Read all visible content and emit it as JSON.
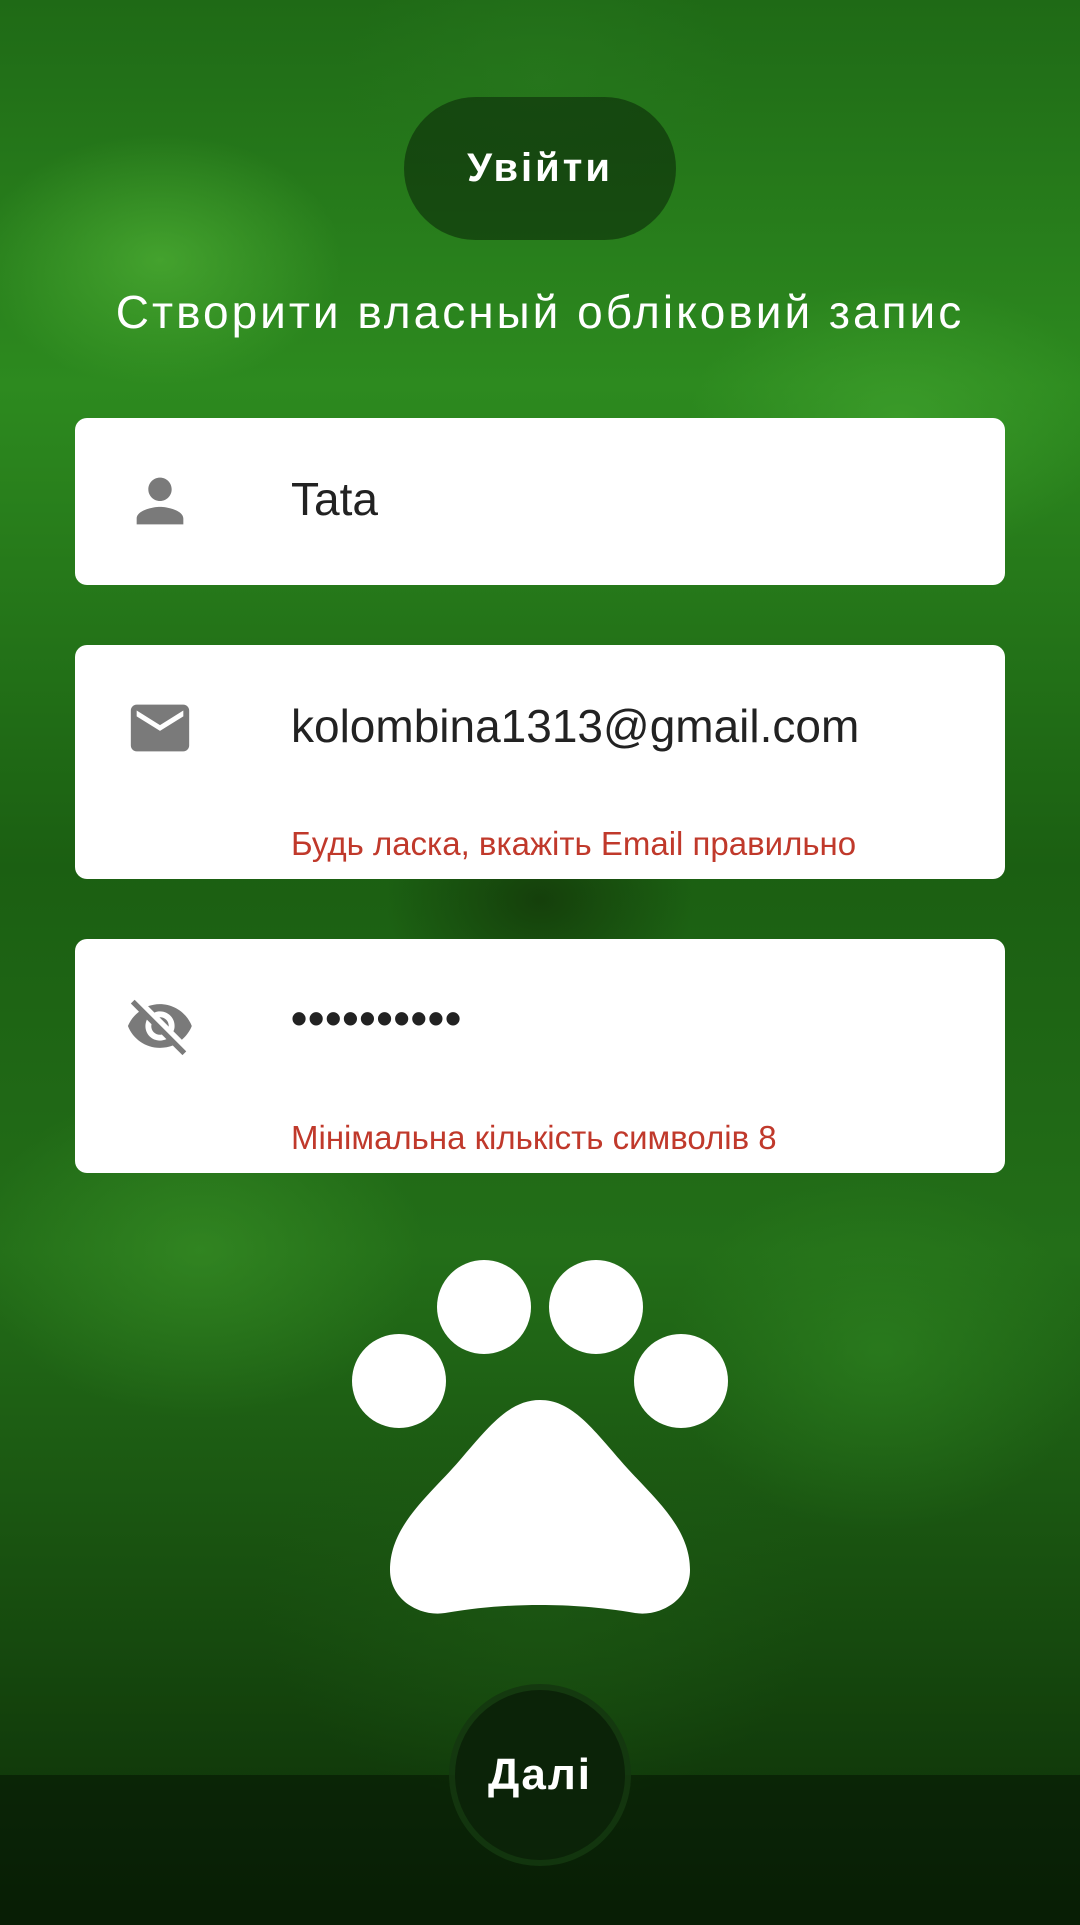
{
  "header": {
    "login_label": "Увійти",
    "title": "Створити власный обліковий запис"
  },
  "form": {
    "name": {
      "icon": "person-icon",
      "value": "Tata"
    },
    "email": {
      "icon": "email-icon",
      "value": "kolombina1313@gmail.com",
      "error": "Будь ласка, вкажіть Email правильно"
    },
    "password": {
      "icon": "visibility-off-icon",
      "value": "••••••••••",
      "error": "Мінімальна кількість символів 8"
    }
  },
  "footer": {
    "next_label": "Далі"
  },
  "colors": {
    "error": "#c0392b",
    "card": "#ffffff",
    "icon": "#7a7a7a"
  }
}
